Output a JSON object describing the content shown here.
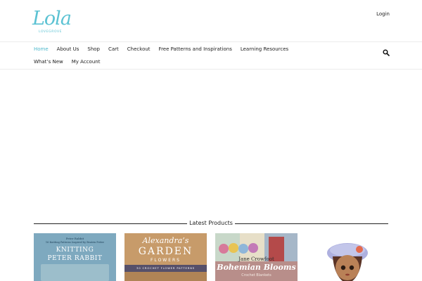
{
  "header": {
    "logo_script": "Lola",
    "logo_sub": "LOVEGROVE",
    "login_label": "Login"
  },
  "nav": {
    "row1": [
      "Home",
      "About Us",
      "Shop",
      "Cart",
      "Checkout",
      "Free Patterns and Inspirations",
      "Learning Resources"
    ],
    "row2": [
      "What’s New",
      "My Account"
    ],
    "active": "Home",
    "search_icon": "search-icon"
  },
  "latest": {
    "title": "Latest Products"
  },
  "products": {
    "p1": {
      "small": "Peter Rabbit",
      "sub": "16 Knitting Patterns Inspired by Beatrix Potter",
      "title_line1": "KNITTING",
      "title_line2": "PETER RABBIT"
    },
    "p2": {
      "script": "Alexandra’s",
      "title": "GARDEN",
      "subtitle": "FLOWERS",
      "small": "30 CROCHET FLOWER PATTERNS"
    },
    "p3": {
      "author": "Jane Crowfoot",
      "title": "Bohemian Blooms",
      "subtitle": "Crochet Blankets"
    }
  },
  "colors": {
    "accent": "#4fb9cc",
    "logo": "#5bc2d3",
    "text": "#222222",
    "divider": "#ececec"
  }
}
